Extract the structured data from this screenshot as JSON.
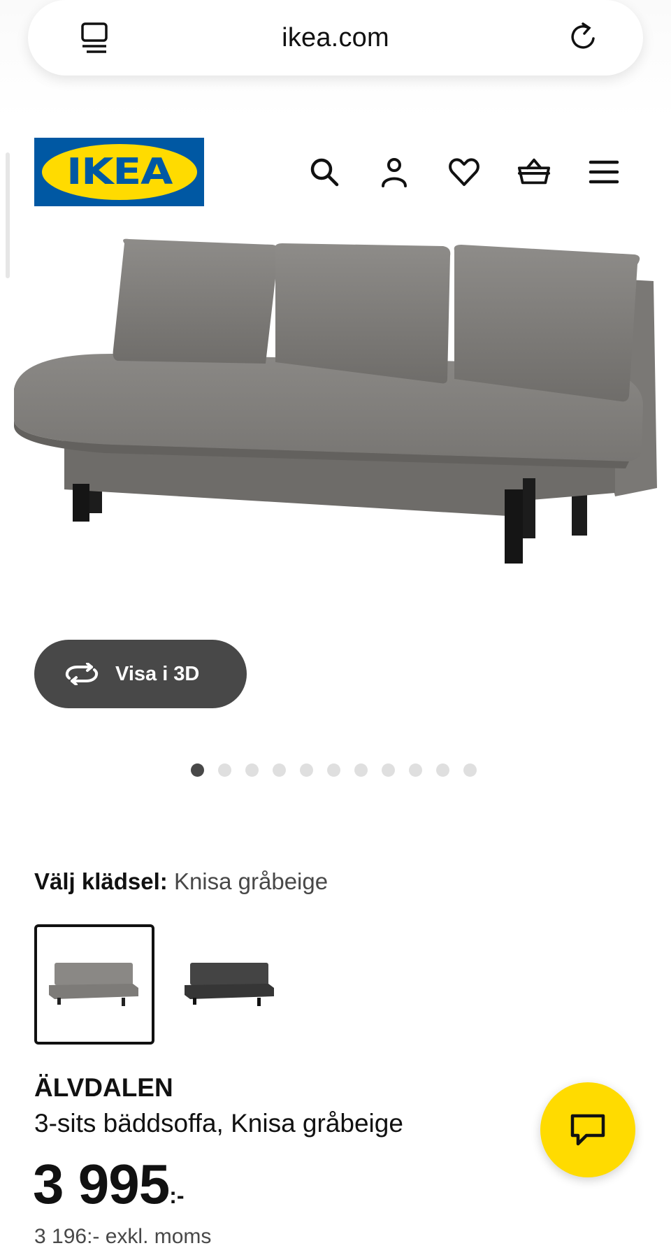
{
  "browser": {
    "url": "ikea.com"
  },
  "header": {
    "logo_text": "IKEA",
    "icons": [
      "search-icon",
      "account-icon",
      "heart-icon",
      "basket-icon",
      "menu-icon"
    ]
  },
  "gallery": {
    "view_3d_label": "Visa i 3D",
    "total_images": 11,
    "active_index": 0
  },
  "variant": {
    "label": "Välj klädsel:",
    "value": "Knisa gråbeige",
    "options": [
      {
        "color": "#7d7b78",
        "selected": true
      },
      {
        "color": "#3a3a3a",
        "selected": false
      }
    ]
  },
  "product": {
    "name": "ÄLVDALEN",
    "description": "3-sits bäddsoffa, Knisa gråbeige",
    "price": "3 995",
    "price_suffix": ":-",
    "price_excl_vat": "3 196:- exkl. moms"
  },
  "colors": {
    "ikea_blue": "#0058a3",
    "ikea_yellow": "#ffdb00",
    "dark_button": "#484848"
  }
}
